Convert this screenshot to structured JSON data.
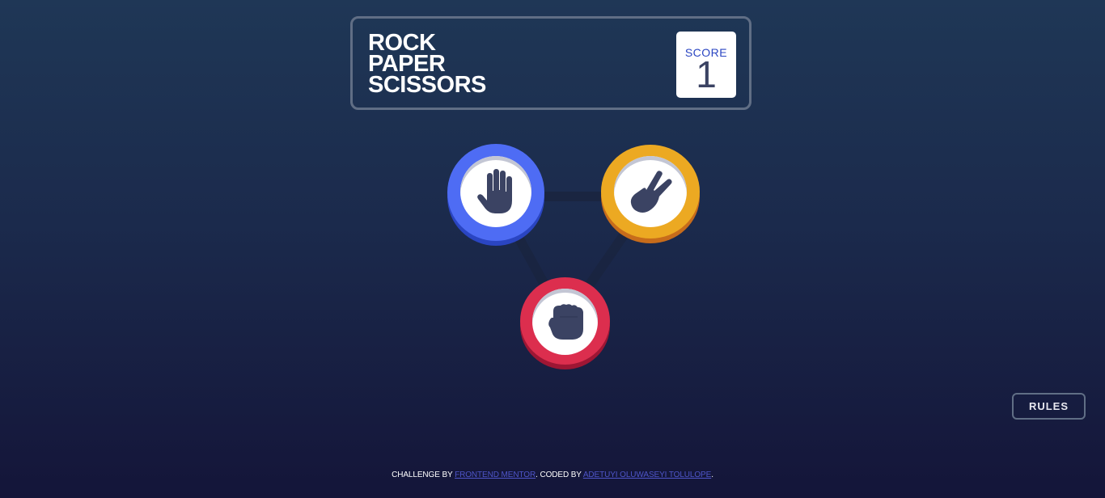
{
  "header": {
    "title_lines": [
      "ROCK",
      "PAPER",
      "SCISSORS"
    ],
    "score_label": "SCORE",
    "score_value": "1"
  },
  "game": {
    "tokens": [
      {
        "name": "paper",
        "icon": "paper-hand-icon",
        "color": "#4e6cf4"
      },
      {
        "name": "scissors",
        "icon": "scissors-hand-icon",
        "color": "#eca922"
      },
      {
        "name": "rock",
        "icon": "rock-fist-icon",
        "color": "#dc2e4e"
      }
    ]
  },
  "rules_button": {
    "label": "RULES"
  },
  "footer": {
    "prefix": "CHALLENGE BY ",
    "link1": "FRONTEND MENTOR",
    "middle": ". CODED BY ",
    "link2": "ADETUYI OLUWASEYI TOLULOPE",
    "suffix": "."
  },
  "colors": {
    "background_top": "#1f3756",
    "background_bottom": "#141539",
    "score_text": "#2a45c2",
    "icon_fill": "#3b4363"
  }
}
